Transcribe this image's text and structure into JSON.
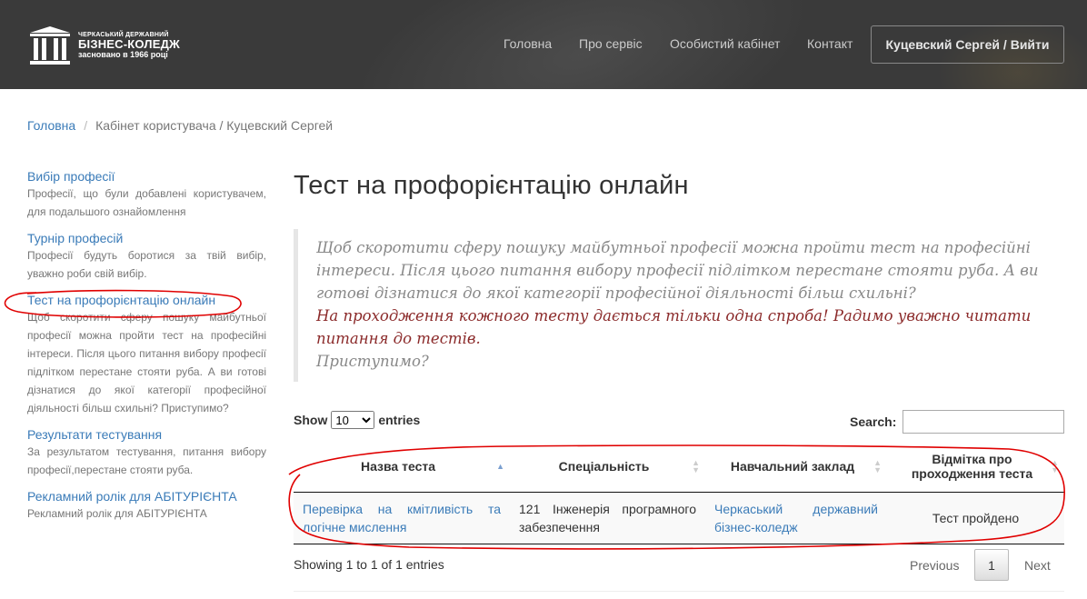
{
  "header": {
    "logo": {
      "line1": "ЧЕРКАСЬКИЙ ДЕРЖАВНИЙ",
      "line2": "БІЗНЕС-КОЛЕДЖ",
      "line3": "засновано в 1966 році"
    },
    "nav": [
      "Головна",
      "Про сервіс",
      "Особистий кабінет",
      "Контакт"
    ],
    "user_button": "Куцевский Сергей / Вийти"
  },
  "breadcrumb": {
    "home": "Головна",
    "current": "Кабінет користувача / Куцевский Сергей"
  },
  "sidebar": {
    "items": [
      {
        "title": "Вибір професії",
        "desc": "Професії, що були добавлені користувачем, для подальшого ознайомлення"
      },
      {
        "title": "Турнір професій",
        "desc": "Професії будуть боротися за твій вибір, уважно роби свій вибір."
      },
      {
        "title": "Тест на профорієнтацію онлайн",
        "desc": "Щоб скоротити сферу пошуку майбутньої професії можна пройти тест на професійні інтереси. Після цього питання вибору професії підлітком перестане стояти руба. А ви готові дізнатися до якої категорії професійної діяльності більш схильні? Приступимо?"
      },
      {
        "title": "Результати тестування",
        "desc": "За результатом тестування, питання вибору професії,перестане стояти руба."
      },
      {
        "title": "Рекламний ролік для АБІТУРІЄНТА",
        "desc": "Рекламний ролік для АБІТУРІЄНТА"
      }
    ]
  },
  "main": {
    "title": "Тест на профорієнтацію онлайн",
    "quote": {
      "intro": "Щоб скоротити сферу пошуку майбутньої професії можна пройти тест на професійні інтереси. Після цього питання вибору професії підлітком перестане стояти руба. А ви готові дізнатися до якої категорії професійної діяльності більш схильні?",
      "warning": "На проходження кожного тесту дається тільки одна спроба! Радимо уважно читати питання до тестів.",
      "outro": "Приступимо?"
    }
  },
  "table": {
    "show_label": "Show",
    "entries_label": "entries",
    "page_size": "10",
    "search_label": "Search:",
    "columns": [
      "Назва теста",
      "Спеціальність",
      "Навчальний заклад",
      "Відмітка про проходження теста"
    ],
    "rows": [
      [
        "Перевірка на кмітливість та логічне мислення",
        "121 Інженерія програмного забезпечення",
        "Черкаський державний бізнес-коледж",
        "Тест пройдено"
      ]
    ],
    "info": "Showing 1 to 1 of 1 entries",
    "previous": "Previous",
    "page": "1",
    "next": "Next"
  },
  "colors": {
    "header_bg": "#3a3a3a",
    "link": "#3a7bb8",
    "warning": "#8b2a2a",
    "annotation": "#e00000"
  }
}
